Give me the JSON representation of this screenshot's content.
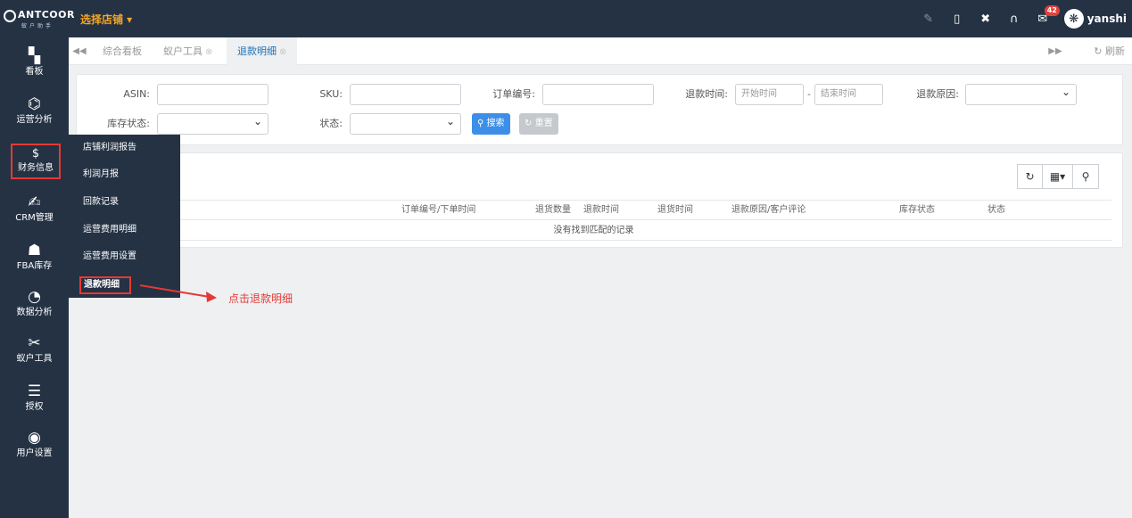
{
  "header": {
    "logo_text": "ANTCOOR",
    "logo_sub": "蚁户助手",
    "store_selector": "选择店铺 ▾",
    "mail_badge": "42",
    "username": "yanshi"
  },
  "sidebar": {
    "items": [
      {
        "label": "看板",
        "icon": "dashboard-icon",
        "glyph": "▚"
      },
      {
        "label": "运营分析",
        "icon": "analytics-icon",
        "glyph": "⌬"
      },
      {
        "label": "财务信息",
        "icon": "finance-icon",
        "glyph": "$"
      },
      {
        "label": "CRM管理",
        "icon": "handshake-icon",
        "glyph": "✍"
      },
      {
        "label": "FBA库存",
        "icon": "users-icon",
        "glyph": "☗"
      },
      {
        "label": "数据分析",
        "icon": "pie-chart-icon",
        "glyph": "◔"
      },
      {
        "label": "蚁户工具",
        "icon": "tools-icon",
        "glyph": "✂"
      },
      {
        "label": "授权",
        "icon": "sliders-icon",
        "glyph": "☰"
      },
      {
        "label": "用户设置",
        "icon": "user-icon",
        "glyph": "◉"
      }
    ]
  },
  "flyout": {
    "items": [
      "店铺利润报告",
      "利润月报",
      "回款记录",
      "运营费用明细",
      "运营费用设置",
      "退款明细"
    ]
  },
  "tabs": {
    "items": [
      {
        "label": "综合看板"
      },
      {
        "label": "蚁户工具"
      },
      {
        "label": "退款明细"
      }
    ],
    "refresh_label": "刷新"
  },
  "filters": {
    "asin_label": "ASIN:",
    "sku_label": "SKU:",
    "order_label": "订单编号:",
    "refund_time_label": "退款时间:",
    "start_placeholder": "开始时间",
    "end_placeholder": "结束时间",
    "reason_label": "退款原因:",
    "stock_label": "库存状态:",
    "status_label": "状态:",
    "search_button": "搜索",
    "reset_button": "重置"
  },
  "table": {
    "columns": [
      "订单编号/下单时间",
      "退货数量",
      "退款时间",
      "退货时间",
      "退款原因/客户评论",
      "库存状态",
      "状态"
    ],
    "empty_text": "没有找到匹配的记录"
  },
  "annotation": {
    "text": "点击退款明细",
    "color": "#e53935"
  },
  "colors": {
    "sidebar_bg": "#243244",
    "accent": "#3d8ee8",
    "store_color": "#f5a623",
    "highlight": "#e53935"
  }
}
